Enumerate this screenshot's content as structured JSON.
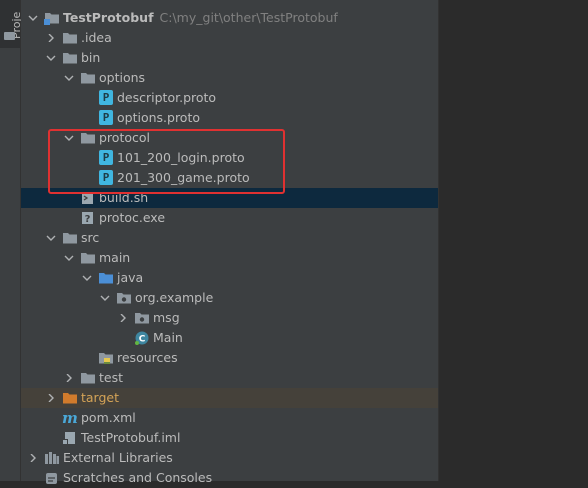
{
  "side_tab": {
    "label": "Proje"
  },
  "tree": [
    {
      "label": "TestProtobuf",
      "path": "C:\\my_git\\other\\TestProtobuf",
      "icon": "module-folder-icon",
      "indent": 0,
      "chevron": "down",
      "bold": true
    },
    {
      "label": ".idea",
      "icon": "folder-icon",
      "indent": 1,
      "chevron": "right"
    },
    {
      "label": "bin",
      "icon": "folder-icon",
      "indent": 1,
      "chevron": "down"
    },
    {
      "label": "options",
      "icon": "folder-icon",
      "indent": 2,
      "chevron": "down"
    },
    {
      "label": "descriptor.proto",
      "icon": "proto-file-icon",
      "icon_text": "P",
      "indent": 3
    },
    {
      "label": "options.proto",
      "icon": "proto-file-icon",
      "icon_text": "P",
      "indent": 3
    },
    {
      "label": "protocol",
      "icon": "folder-icon",
      "indent": 2,
      "chevron": "down"
    },
    {
      "label": "101_200_login.proto",
      "icon": "proto-file-icon",
      "icon_text": "P",
      "indent": 3
    },
    {
      "label": "201_300_game.proto",
      "icon": "proto-file-icon",
      "icon_text": "P",
      "indent": 3
    },
    {
      "label": "build.sh",
      "icon": "shell-script-icon",
      "indent": 2,
      "selected": true
    },
    {
      "label": "protoc.exe",
      "icon": "unknown-file-icon",
      "indent": 2
    },
    {
      "label": "src",
      "icon": "folder-icon",
      "indent": 1,
      "chevron": "down"
    },
    {
      "label": "main",
      "icon": "folder-icon",
      "indent": 2,
      "chevron": "down"
    },
    {
      "label": "java",
      "icon": "source-folder-icon",
      "indent": 3,
      "chevron": "down"
    },
    {
      "label": "org.example",
      "icon": "package-icon",
      "indent": 4,
      "chevron": "down"
    },
    {
      "label": "msg",
      "icon": "package-icon",
      "indent": 5,
      "chevron": "right"
    },
    {
      "label": "Main",
      "icon": "java-class-icon",
      "icon_text": "C",
      "indent": 5
    },
    {
      "label": "resources",
      "icon": "resources-folder-icon",
      "indent": 3
    },
    {
      "label": "test",
      "icon": "folder-icon",
      "indent": 2,
      "chevron": "right"
    },
    {
      "label": "target",
      "icon": "excluded-folder-icon",
      "indent": 1,
      "chevron": "right",
      "excluded": true
    },
    {
      "label": "pom.xml",
      "icon": "maven-icon",
      "icon_text": "m",
      "indent": 1
    },
    {
      "label": "TestProtobuf.iml",
      "icon": "iml-file-icon",
      "indent": 1
    },
    {
      "label": "External Libraries",
      "icon": "libraries-icon",
      "indent": 0,
      "chevron": "right"
    },
    {
      "label": "Scratches and Consoles",
      "icon": "scratches-icon",
      "indent": 0
    }
  ],
  "colors": {
    "panel": "#3c3f41",
    "selection": "#0d293e",
    "folder": "#8f98a0",
    "source_folder": "#4b8fd6",
    "excluded_folder": "#d17b2c",
    "proto": "#40b6e0",
    "highlight": "#e03131"
  }
}
